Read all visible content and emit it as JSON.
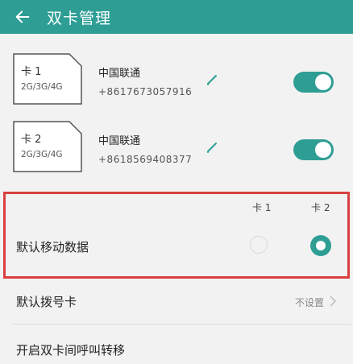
{
  "header": {
    "title": "双卡管理",
    "back_icon": "arrow-left-icon",
    "bg_color": "#2e9e95"
  },
  "sims": [
    {
      "name": "卡 1",
      "network": "2G/3G/4G",
      "carrier": "中国联通",
      "phone": "+8617673057916",
      "enabled": true
    },
    {
      "name": "卡 2",
      "network": "2G/3G/4G",
      "carrier": "中国联通",
      "phone": "+8618569408377",
      "enabled": true
    }
  ],
  "default_data": {
    "label": "默认移动数据",
    "col1": "卡 1",
    "col2": "卡 2",
    "selected": "卡 2"
  },
  "default_dial": {
    "label": "默认拨号卡",
    "value": "不设置"
  },
  "call_forward": {
    "label": "开启双卡间呼叫转移"
  },
  "highlight_color": "#d94040"
}
